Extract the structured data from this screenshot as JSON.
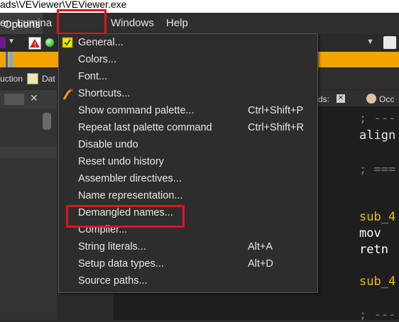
{
  "window": {
    "title": "ads\\VEViewer\\VEViewer.exe"
  },
  "menubar": {
    "items": [
      "er",
      "Lumina",
      "Options",
      "Windows",
      "Help"
    ]
  },
  "legend": {
    "items": [
      "uction",
      "Dat"
    ]
  },
  "tabs": {
    "tab1": "ds:",
    "tab2": "Occ"
  },
  "dropdown": {
    "items": [
      {
        "label": "General...",
        "shortcut": ""
      },
      {
        "label": "Colors...",
        "shortcut": ""
      },
      {
        "label": "Font...",
        "shortcut": ""
      },
      {
        "label": "Shortcuts...",
        "shortcut": ""
      },
      {
        "label": "Show command palette...",
        "shortcut": "Ctrl+Shift+P"
      },
      {
        "label": "Repeat last palette command",
        "shortcut": "Ctrl+Shift+R"
      },
      {
        "label": "Disable undo",
        "shortcut": ""
      },
      {
        "label": "Reset undo history",
        "shortcut": ""
      },
      {
        "label": "Assembler directives...",
        "shortcut": ""
      },
      {
        "label": "Name representation...",
        "shortcut": ""
      },
      {
        "label": "Demangled names...",
        "shortcut": ""
      },
      {
        "label": "Compiler...",
        "shortcut": ""
      },
      {
        "label": "String literals...",
        "shortcut": "Alt+A"
      },
      {
        "label": "Setup data types...",
        "shortcut": "Alt+D"
      },
      {
        "label": "Source paths...",
        "shortcut": ""
      }
    ]
  },
  "code": {
    "lines": [
      "; ---",
      "align",
      "; ===",
      "sub_4",
      "mov",
      "retn",
      "sub_4",
      "; ---"
    ]
  },
  "colors": {
    "accent_highlight": "#e0141e",
    "nav_band": "#f5a300",
    "label_yellow": "#e8c000"
  }
}
